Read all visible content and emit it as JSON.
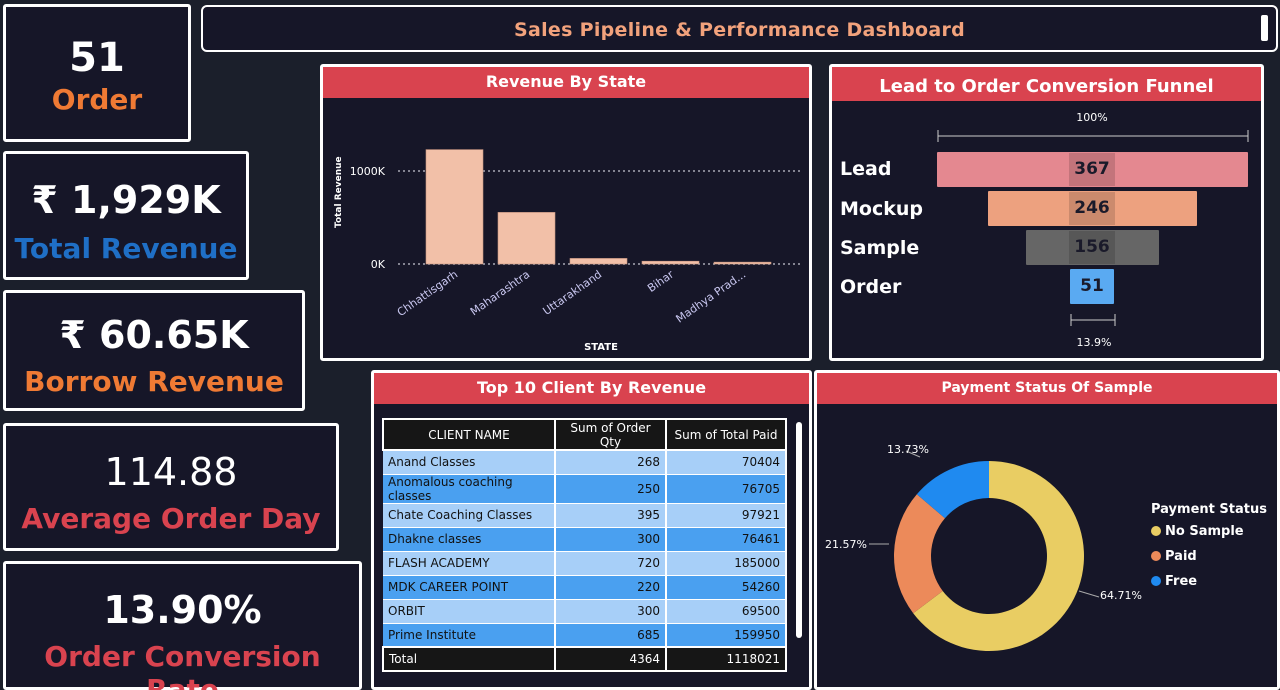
{
  "title": "Sales Pipeline & Performance Dashboard",
  "kpis": [
    {
      "value": "51",
      "label": "Order",
      "label_color": "#ef7a34"
    },
    {
      "value": "₹ 1,929K",
      "label": "Total Revenue",
      "label_color": "#1f6fc6"
    },
    {
      "value": "₹ 60.65K",
      "label": "Borrow Revenue",
      "label_color": "#ef7a34"
    },
    {
      "value": "114.88",
      "label": "Average Order Day",
      "label_color": "#d9434f"
    },
    {
      "value": "13.90%",
      "label": "Order Conversion Rate",
      "label_color": "#d9434f"
    }
  ],
  "revenue_chart": {
    "title": "Revenue By State",
    "chart_data": {
      "type": "bar",
      "categories": [
        "Chhattisgarh",
        "Maharashtra",
        "Uttarakhand",
        "Bihar",
        "Madhya Prad..."
      ],
      "values": [
        1230,
        555,
        60,
        30,
        20
      ],
      "xlabel": "STATE",
      "ylabel": "Total Revenue",
      "yticks": [
        "0K",
        "1000K"
      ],
      "ylim": [
        0,
        1300
      ],
      "bar_color": "#f2c0a8",
      "grid": true
    }
  },
  "funnel": {
    "title": "Lead to Order Conversion Funnel",
    "top_pct": "100%",
    "bottom_pct": "13.9%",
    "stages": [
      {
        "label": "Lead",
        "value": "367",
        "color": "#e48890"
      },
      {
        "label": "Mockup",
        "value": "246",
        "color": "#eda17f"
      },
      {
        "label": "Sample",
        "value": "156",
        "color": "#666666"
      },
      {
        "label": "Order",
        "value": "51",
        "color": "#5aaaf2"
      }
    ]
  },
  "clients_table": {
    "title": "Top 10 Client By Revenue",
    "headers": [
      "CLIENT NAME",
      "Sum of Order Qty",
      "Sum of Total Paid"
    ],
    "rows": [
      [
        "Anand Classes",
        "268",
        "70404"
      ],
      [
        "Anomalous coaching classes",
        "250",
        "76705"
      ],
      [
        "Chate Coaching Classes",
        "395",
        "97921"
      ],
      [
        "Dhakne classes",
        "300",
        "76461"
      ],
      [
        "FLASH ACADEMY",
        "720",
        "185000"
      ],
      [
        "MDK CAREER POINT",
        "220",
        "54260"
      ],
      [
        "ORBIT",
        "300",
        "69500"
      ],
      [
        "Prime Institute",
        "685",
        "159950"
      ]
    ],
    "total": [
      "Total",
      "4364",
      "1118021"
    ]
  },
  "payment_chart": {
    "title": "Payment Status Of Sample",
    "legend_title": "Payment Status",
    "chart_data": {
      "type": "pie",
      "categories": [
        "No Sample",
        "Paid",
        "Free"
      ],
      "values": [
        64.71,
        21.57,
        13.73
      ],
      "labels": [
        "64.71%",
        "21.57%",
        "13.73%"
      ],
      "colors": [
        "#e9cd63",
        "#ec8a5a",
        "#1f8af0"
      ],
      "legend_position": "right"
    }
  }
}
